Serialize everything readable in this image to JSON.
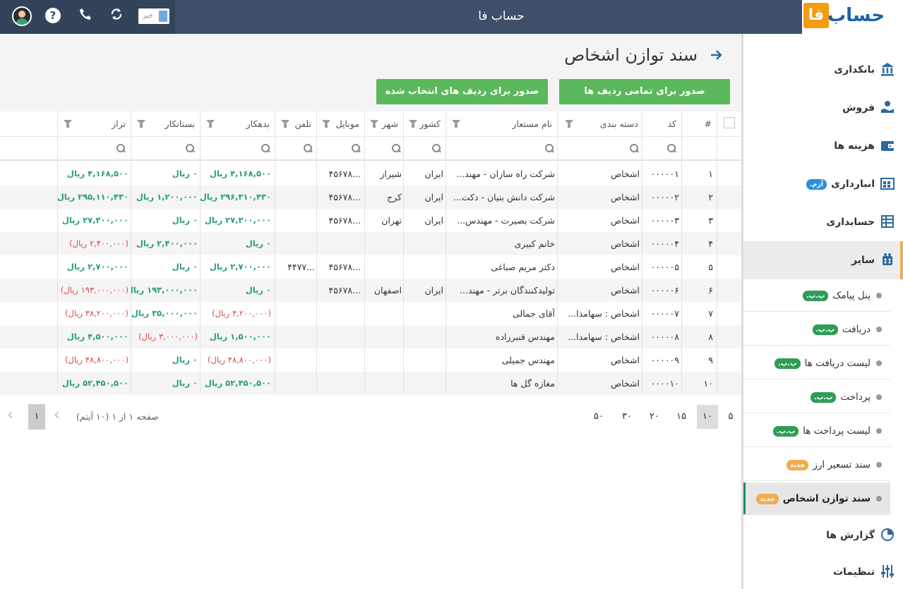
{
  "header": {
    "app_title": "حساب فا",
    "logo_text": "حساب",
    "logo_letter": "فا",
    "news_label": "خبر",
    "help_symbol": "?",
    "icons": [
      "avatar",
      "help-icon",
      "phone-icon",
      "sync-icon",
      "news-toggle"
    ]
  },
  "page": {
    "title": "سند توازن اشخاص",
    "btn_all": "صدور برای تمامی ردیف ها",
    "btn_selected": "صدور برای ردیف های انتخاب شده"
  },
  "table": {
    "columns": {
      "num": "#",
      "code": "کد",
      "category": "دسته بندی",
      "name": "نام مستعار",
      "country": "کشور",
      "city": "شهر",
      "mobile": "موبایل",
      "phone": "تلفن",
      "debtor": "بدهکار",
      "creditor": "بستانکار",
      "balance": "تراز"
    },
    "rows": [
      {
        "num": "۱",
        "code": "۰۰۰۰۰۱",
        "category": "اشخاص",
        "name": "شرکت راه سازان - مهند...",
        "country": "ایران",
        "city": "شیراز",
        "mobile": "...۴۵۶۷۸",
        "phone": "",
        "debtor": "۴,۱۶۸,۵۰۰ ریال",
        "creditor": "۰ ریال",
        "balance": "۴,۱۶۸,۵۰۰ ریال",
        "debtor_neg": false,
        "creditor_neg": false,
        "balance_neg": false
      },
      {
        "num": "۲",
        "code": "۰۰۰۰۰۲",
        "category": "اشخاص",
        "name": "شرکت دانش بنیان - دکت...",
        "country": "ایران",
        "city": "کرج",
        "mobile": "...۴۵۶۷۸",
        "phone": "",
        "debtor": "۲۹۶,۳۱۰,۴۳۰ ریال",
        "creditor": "۱,۲۰۰,۰۰۰ ریال",
        "balance": "۲۹۵,۱۱۰,۴۳۰ ریال",
        "debtor_neg": false,
        "creditor_neg": false,
        "balance_neg": false
      },
      {
        "num": "۳",
        "code": "۰۰۰۰۰۳",
        "category": "اشخاص",
        "name": "شرکت بصیرت - مهندس...",
        "country": "ایران",
        "city": "تهران",
        "mobile": "...۴۵۶۷۸",
        "phone": "",
        "debtor": "۲۷,۳۰۰,۰۰۰ ریال",
        "creditor": "۰ ریال",
        "balance": "۲۷,۳۰۰,۰۰۰ ریال",
        "debtor_neg": false,
        "creditor_neg": false,
        "balance_neg": false
      },
      {
        "num": "۴",
        "code": "۰۰۰۰۰۴",
        "category": "اشخاص",
        "name": "خانم کبیری",
        "country": "",
        "city": "",
        "mobile": "",
        "phone": "",
        "debtor": "۰ ریال",
        "creditor": "۲,۴۰۰,۰۰۰ ریال",
        "balance": "(۲,۴۰۰,۰۰۰ ریال)",
        "debtor_neg": false,
        "creditor_neg": false,
        "balance_neg": true
      },
      {
        "num": "۵",
        "code": "۰۰۰۰۰۵",
        "category": "اشخاص",
        "name": "دکتر مریم صباغی",
        "country": "",
        "city": "",
        "mobile": "...۴۵۶۷۸",
        "phone": "...۴۴۷۷",
        "debtor": "۲,۷۰۰,۰۰۰ ریال",
        "creditor": "۰ ریال",
        "balance": "۲,۷۰۰,۰۰۰ ریال",
        "debtor_neg": false,
        "creditor_neg": false,
        "balance_neg": false
      },
      {
        "num": "۶",
        "code": "۰۰۰۰۰۶",
        "category": "اشخاص",
        "name": "تولیدکنندگان برتر - مهند...",
        "country": "ایران",
        "city": "اصفهان",
        "mobile": "...۴۵۶۷۸",
        "phone": "",
        "debtor": "۰ ریال",
        "creditor": "۱۹۳,۰۰۰,۰۰۰ ریال",
        "balance": "(۱۹۳,۰۰۰,۰۰۰ ریال)",
        "debtor_neg": false,
        "creditor_neg": false,
        "balance_neg": true
      },
      {
        "num": "۷",
        "code": "۰۰۰۰۰۷",
        "category": "اشخاص : سهامدا...",
        "name": "آقای جمالی",
        "country": "",
        "city": "",
        "mobile": "",
        "phone": "",
        "debtor": "(۳,۲۰۰,۰۰۰ ریال)",
        "creditor": "۳۵,۰۰۰,۰۰۰ ریال",
        "balance": "(۳۸,۲۰۰,۰۰۰ ریال)",
        "debtor_neg": true,
        "creditor_neg": false,
        "balance_neg": true
      },
      {
        "num": "۸",
        "code": "۰۰۰۰۰۸",
        "category": "اشخاص : سهامدا...",
        "name": "مهندس قنبرزاده",
        "country": "",
        "city": "",
        "mobile": "",
        "phone": "",
        "debtor": "۱,۵۰۰,۰۰۰ ریال",
        "creditor": "(۳,۰۰۰,۰۰۰ ریال)",
        "balance": "۴,۵۰۰,۰۰۰ ریال",
        "debtor_neg": false,
        "creditor_neg": true,
        "balance_neg": false
      },
      {
        "num": "۹",
        "code": "۰۰۰۰۰۹",
        "category": "اشخاص",
        "name": "مهندس جمیلی",
        "country": "",
        "city": "",
        "mobile": "",
        "phone": "",
        "debtor": "(۴۸,۸۰۰,۰۰۰ ریال)",
        "creditor": "۰ ریال",
        "balance": "(۴۸,۸۰۰,۰۰۰ ریال)",
        "debtor_neg": true,
        "creditor_neg": false,
        "balance_neg": true
      },
      {
        "num": "۱۰",
        "code": "۰۰۰۰۱۰",
        "category": "اشخاص",
        "name": "مغازه گل ها",
        "country": "",
        "city": "",
        "mobile": "",
        "phone": "",
        "debtor": "۵۲,۴۵۰,۵۰۰ ریال",
        "creditor": "۰ ریال",
        "balance": "۵۲,۴۵۰,۵۰۰ ریال",
        "debtor_neg": false,
        "creditor_neg": false,
        "balance_neg": false
      }
    ]
  },
  "pager": {
    "sizes": [
      "۵",
      "۱۰",
      "۱۵",
      "۲۰",
      "۳۰",
      "۵۰"
    ],
    "selected_size": "۱۰",
    "info": "صفحه ۱ از ۱ (۱۰ آیتم)",
    "current_page": "۱"
  },
  "sidebar": {
    "items": [
      {
        "label": "بانکداری",
        "icon": "bank-icon"
      },
      {
        "label": "فروش",
        "icon": "sales-icon"
      },
      {
        "label": "هزینه ها",
        "icon": "wallet-icon"
      },
      {
        "label": "انبارداری",
        "icon": "warehouse-icon",
        "badge": "آزم."
      },
      {
        "label": "حسابداری",
        "icon": "ledger-icon"
      },
      {
        "label": "سایر",
        "icon": "other-icon"
      },
      {
        "label": "گزارش ها",
        "icon": "report-icon"
      },
      {
        "label": "تنظیمات",
        "icon": "settings-icon"
      }
    ],
    "subitems": [
      {
        "label": "پنل پیامک",
        "badge": "پ.پ."
      },
      {
        "label": "دریافت",
        "badge": "پ.پ."
      },
      {
        "label": "لیست دریافت ها",
        "badge": "پ.پ."
      },
      {
        "label": "پرداخت",
        "badge": "پ.پ."
      },
      {
        "label": "لیست پرداخت ها",
        "badge": "پ.پ."
      },
      {
        "label": "سند تسعیر ارز",
        "badge": "جدید"
      },
      {
        "label": "سند توازن اشخاص",
        "badge": "جدید"
      }
    ]
  },
  "colors": {
    "header_bg": "#3e5069",
    "positive": "#2a9d78",
    "negative": "#e04646",
    "button_green": "#5cb85c",
    "accent_orange": "#f0ad4e"
  }
}
